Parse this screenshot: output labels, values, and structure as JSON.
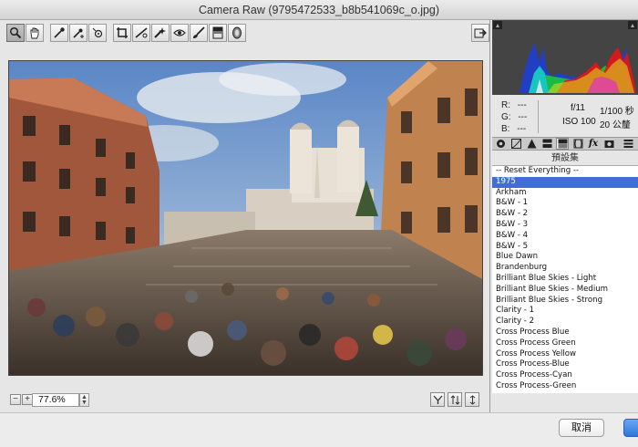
{
  "window": {
    "title": "Camera Raw (9795472533_b8b541069c_o.jpg)"
  },
  "toolbar": {
    "tools": [
      "zoom-icon",
      "hand-icon",
      "white-balance-icon",
      "color-sampler-icon",
      "targeted-adjust-icon",
      "crop-icon",
      "straighten-icon",
      "spot-removal-icon",
      "red-eye-icon",
      "adjustment-brush-icon",
      "graduated-filter-icon",
      "radial-filter-icon"
    ],
    "active_tool": "zoom-icon"
  },
  "statusbar": {
    "zoom_value": "77.6%"
  },
  "readout": {
    "r_label": "R:",
    "r_value": "---",
    "g_label": "G:",
    "g_value": "---",
    "b_label": "B:",
    "b_value": "---",
    "aperture": "f/11",
    "shutter": "1/100 秒",
    "iso": "ISO 100",
    "focal": "20 公釐"
  },
  "panel_tabs": [
    "basic-icon",
    "tone-curve-icon",
    "detail-icon",
    "hsl-icon",
    "split-toning-icon",
    "lens-icon",
    "fx-icon",
    "camera-calibration-icon",
    "presets-icon"
  ],
  "presets": {
    "heading": "預設集",
    "selected_index": 1,
    "items": [
      "-- Reset Everything --",
      "1975",
      "Arkham",
      "B&W - 1",
      "B&W - 2",
      "B&W - 3",
      "B&W - 4",
      "B&W - 5",
      "Blue Dawn",
      "Brandenburg",
      "Brilliant Blue Skies - Light",
      "Brilliant Blue Skies - Medium",
      "Brilliant Blue Skies - Strong",
      "Clarity - 1",
      "Clarity - 2",
      "Cross Process Blue",
      "Cross Process Green",
      "Cross Process Yellow",
      "Cross Process-Blue",
      "Cross Process-Cyan",
      "Cross Process-Green"
    ]
  },
  "footer": {
    "cancel_label": "取消"
  },
  "colors": {
    "selection": "#3f6ed6",
    "histogram_bg": "#444444"
  }
}
